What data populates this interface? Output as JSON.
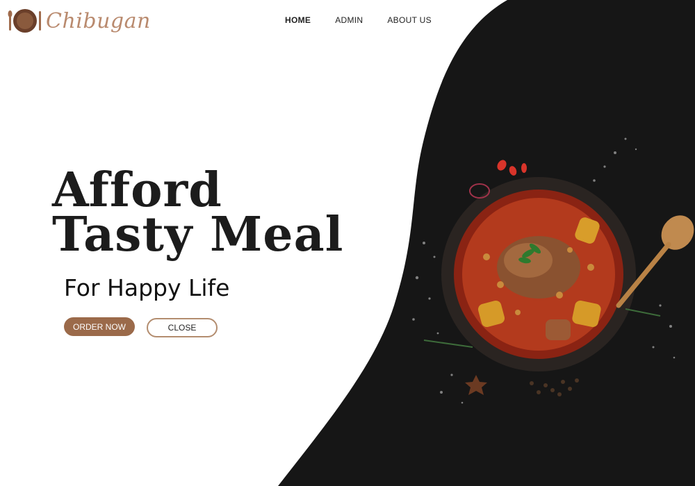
{
  "brand": {
    "name": "Chibugan"
  },
  "nav": {
    "items": [
      {
        "label": "HOME"
      },
      {
        "label": "ADMIN"
      },
      {
        "label": "ABOUT US"
      }
    ]
  },
  "hero": {
    "title_line1": "Afford",
    "title_line2": "Tasty Meal",
    "subtitle": "For Happy Life",
    "order_label": "ORDER NOW",
    "close_label": "CLOSE"
  },
  "colors": {
    "accent": "#9b6a4a",
    "dark_panel": "#161616",
    "close_border": "#b38d6f"
  },
  "icons": [
    "logo-plate-icon",
    "food-bowl-image"
  ]
}
